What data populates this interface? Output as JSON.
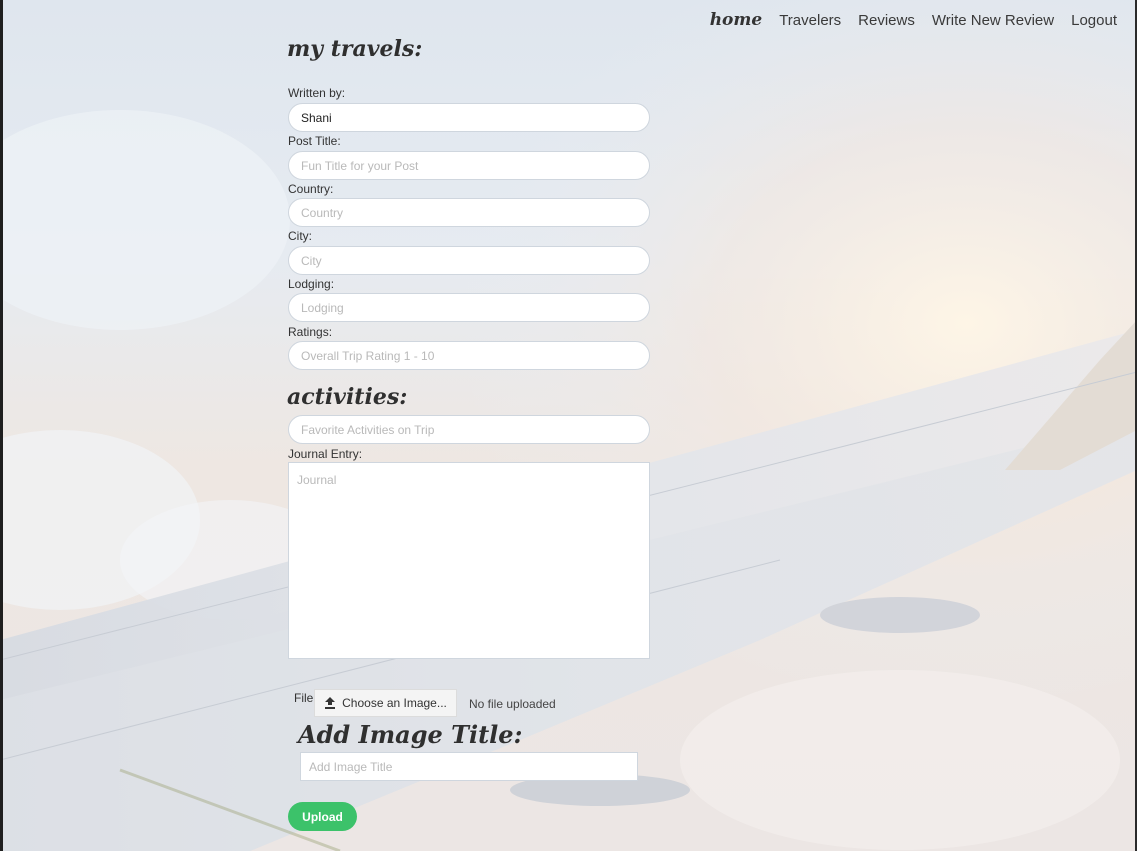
{
  "nav": {
    "home": "home",
    "travelers": "Travelers",
    "reviews": "Reviews",
    "write_new_review": "Write New Review",
    "logout": "Logout"
  },
  "form": {
    "heading": "my travels:",
    "written_by": {
      "label": "Written by:",
      "value": "Shani"
    },
    "post_title": {
      "label": "Post Title:",
      "placeholder": "Fun Title for your Post"
    },
    "country": {
      "label": "Country:",
      "placeholder": "Country"
    },
    "city": {
      "label": "City:",
      "placeholder": "City"
    },
    "lodging": {
      "label": "Lodging:",
      "placeholder": "Lodging"
    },
    "ratings": {
      "label": "Ratings:",
      "placeholder": "Overall Trip Rating 1 - 10"
    },
    "activities_heading": "activities:",
    "activities": {
      "placeholder": "Favorite Activities on Trip"
    },
    "journal": {
      "label": "Journal Entry:",
      "placeholder": "Journal"
    },
    "file": {
      "label": "File:",
      "button_label": "Choose an Image...",
      "button_icon": "upload-icon",
      "status": "No file uploaded"
    },
    "image_title_heading": "Add Image Title:",
    "image_title": {
      "placeholder": "Add Image Title"
    },
    "upload_label": "Upload"
  },
  "colors": {
    "upload_button": "#3cc26a",
    "field_background": "#ffffff"
  }
}
